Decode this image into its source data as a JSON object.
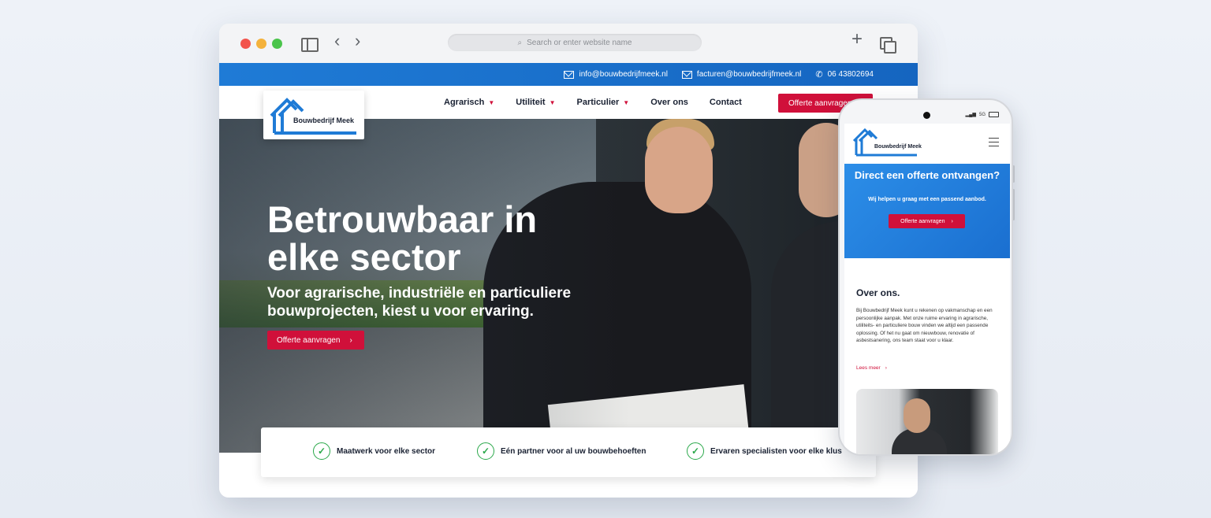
{
  "browser": {
    "address_placeholder": "Search or enter website name"
  },
  "topbar": {
    "email1": "info@bouwbedrijfmeek.nl",
    "email2": "facturen@bouwbedrijfmeek.nl",
    "phone": "06 43802694"
  },
  "brand": {
    "name": "Bouwbedrijf Meek",
    "colors": {
      "primary_blue": "#1f7bd6",
      "accent_red": "#d0103a",
      "check_green": "#2aa84a"
    }
  },
  "nav": {
    "items": [
      {
        "label": "Agrarisch",
        "dropdown": true
      },
      {
        "label": "Utiliteit",
        "dropdown": true
      },
      {
        "label": "Particulier",
        "dropdown": true
      },
      {
        "label": "Over ons",
        "dropdown": false
      },
      {
        "label": "Contact",
        "dropdown": false
      }
    ],
    "cta": "Offerte aanvragen"
  },
  "hero": {
    "title": "Betrouwbaar in elke sector",
    "subtitle": "Voor agrarische, industriële en particuliere bouwprojecten, kiest u voor ervaring.",
    "cta": "Offerte aanvragen"
  },
  "usps": [
    "Maatwerk voor elke sector",
    "Eén partner voor al uw bouwbehoeften",
    "Ervaren specialisten voor elke klus"
  ],
  "mobile": {
    "status": "5G",
    "cta_title": "Direct een offerte ontvangen?",
    "cta_subtitle": "Wij helpen u graag met een passend aanbod.",
    "cta_button": "Offerte aanvragen",
    "about_title": "Over ons.",
    "about_text": "Bij Bouwbedrijf Meek kunt u rekenen op vakmanschap en een persoonlijke aanpak. Met onze ruime ervaring in agrarische, utiliteits- en particuliere bouw vinden we altijd een passende oplossing. Of het nu gaat om nieuwbouw, renovatie of asbestsanering, ons team staat voor u klaar.",
    "read_more": "Lees meer"
  }
}
